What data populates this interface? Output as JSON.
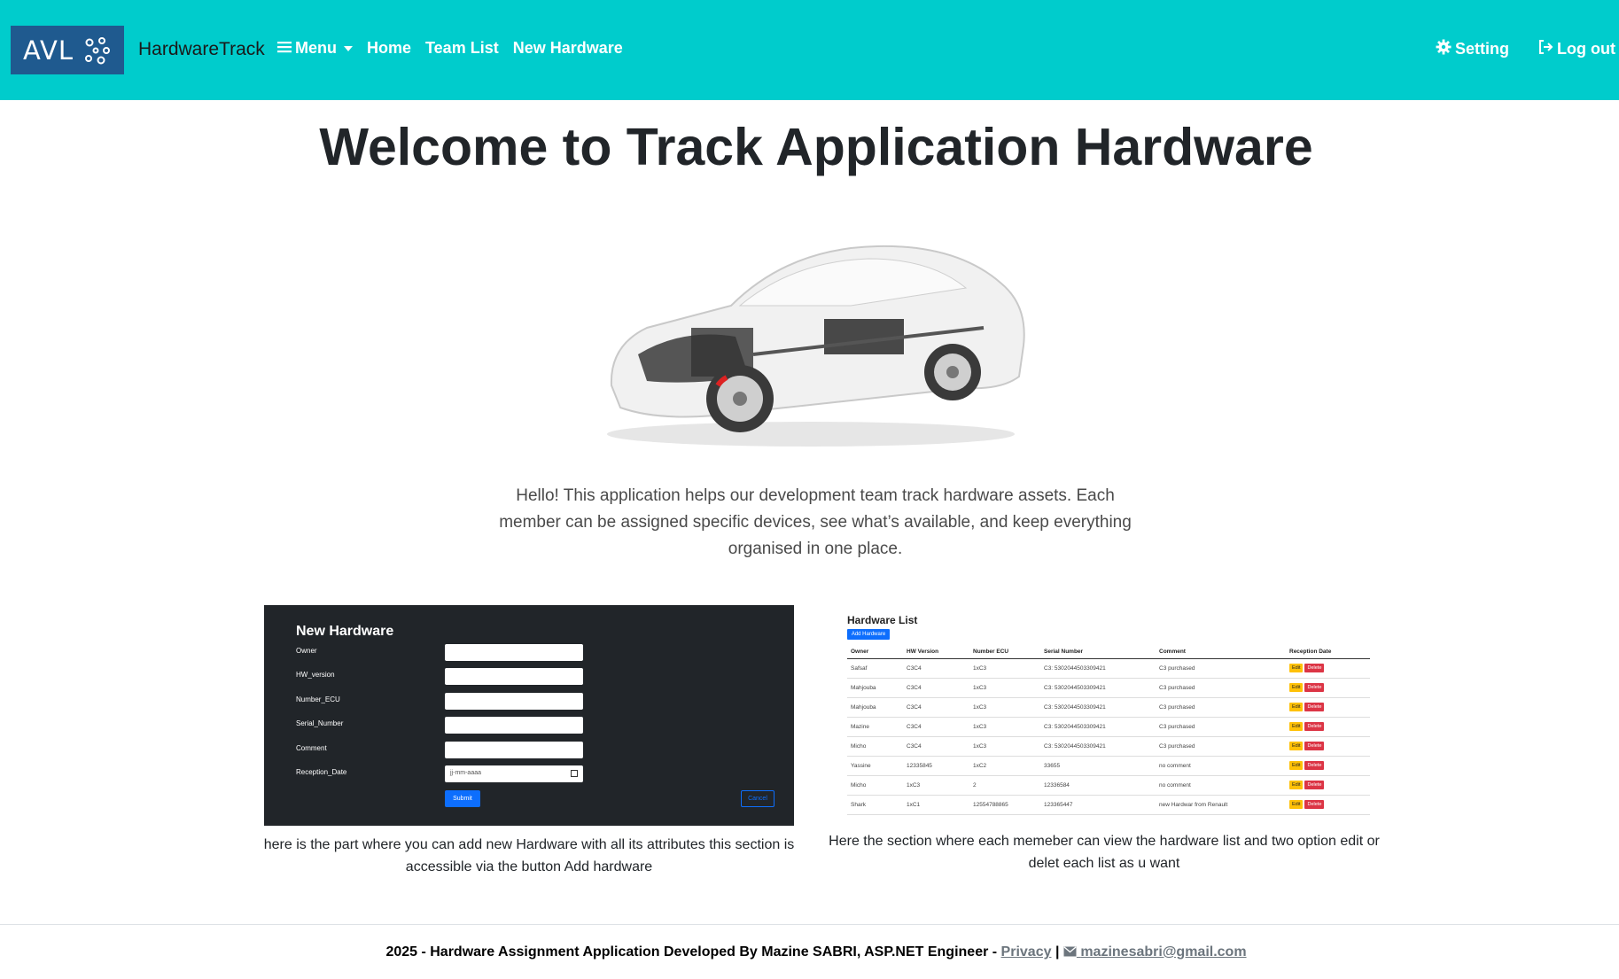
{
  "navbar": {
    "logo_text": "AVL",
    "brand": "HardwareTrack",
    "links": [
      {
        "label": "Menu",
        "icon": "menu-icon"
      },
      {
        "label": "Home"
      },
      {
        "label": "Team List"
      },
      {
        "label": "New Hardware"
      }
    ],
    "right_links": [
      {
        "label": "Setting",
        "icon": "gear-icon"
      },
      {
        "label": "Log out",
        "icon": "logout-icon"
      }
    ],
    "color": "#00cccc",
    "logo_bg": "#1f5a8f"
  },
  "hero": {
    "title": "Welcome to Track Application Hardware",
    "intro": "Hello! This application helps our development team track hardware assets. Each member can be assigned specific devices, see what’s available, and keep everything organised in one place."
  },
  "form_preview": {
    "title": "New Hardware",
    "fields": [
      {
        "label": "Owner",
        "value": ""
      },
      {
        "label": "HW_version",
        "value": ""
      },
      {
        "label": "Number_ECU",
        "value": ""
      },
      {
        "label": "Serial_Number",
        "value": ""
      },
      {
        "label": "Comment",
        "value": ""
      },
      {
        "label": "Reception_Date",
        "value": "jj-mm-aaaa"
      }
    ],
    "submit": "Submit",
    "cancel": "Cancel",
    "caption": "here is the part where you can add new Hardware with all its attributes this section is accessible via the button Add hardware"
  },
  "list_preview": {
    "title": "Hardware List",
    "add_button": "Add Hardware",
    "columns": [
      "Owner",
      "HW Version",
      "Number ECU",
      "Serial Number",
      "Comment",
      "Reception Date"
    ],
    "rows": [
      [
        "Safsaf",
        "C3C4",
        "1xC3",
        "C3: 5302044503309421",
        "C3 purchased"
      ],
      [
        "Mahjouba",
        "C3C4",
        "1xC3",
        "C3: 5302044503309421",
        "C3 purchased"
      ],
      [
        "Mahjouba",
        "C3C4",
        "1xC3",
        "C3: 5302044503309421",
        "C3 purchased"
      ],
      [
        "Mazine",
        "C3C4",
        "1xC3",
        "C3: 5302044503309421",
        "C3 purchased"
      ],
      [
        "Micho",
        "C3C4",
        "1xC3",
        "C3: 5302044503309421",
        "C3 purchased"
      ],
      [
        "Yassine",
        "12335845",
        "1xC2",
        "33655",
        "no comment"
      ],
      [
        "Micho",
        "1xC3",
        "2",
        "12336584",
        "no comment"
      ],
      [
        "Shark",
        "1xC1",
        "12554788865",
        "123365447",
        "new Hardwar from Renault"
      ]
    ],
    "edit_label": "Edit",
    "delete_label": "Delete",
    "caption": "Here the section where each memeber can view the hardware list and two option edit or delet each list as u want"
  },
  "footer": {
    "text": "2025 - Hardware Assignment Application Developed By Mazine SABRI, ASP.NET Engineer -",
    "privacy": "Privacy",
    "separator": "|",
    "email": "mazinesabri@gmail.com"
  }
}
